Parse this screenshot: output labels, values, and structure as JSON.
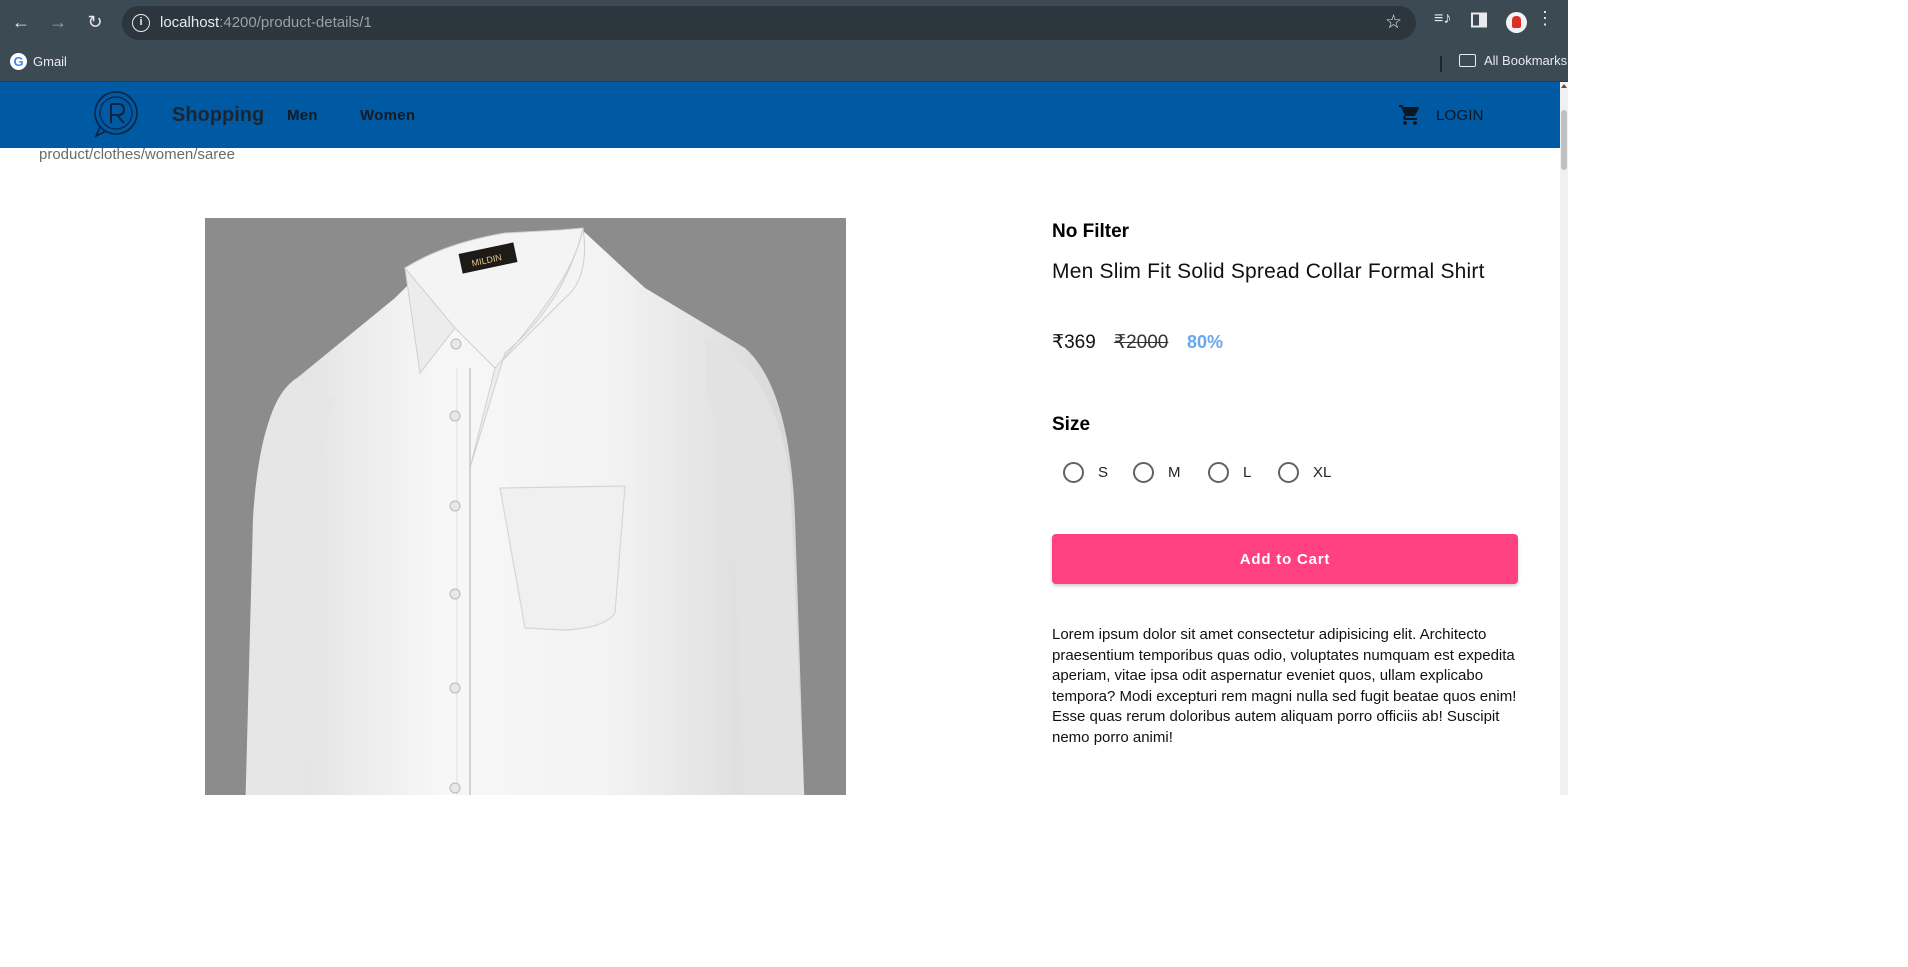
{
  "browser": {
    "url_host": "localhost",
    "url_path": ":4200/product-details/1",
    "bookmarks": {
      "gmail": "Gmail",
      "all": "All Bookmarks"
    }
  },
  "toolbar": {
    "brand": "Shopping",
    "nav": [
      "Men",
      "Women"
    ],
    "login": "LOGIN"
  },
  "breadcrumb": "product/clothes/women/saree",
  "product": {
    "image_label": "MILDIN",
    "filter_title": "No Filter",
    "title": "Men Slim Fit Solid Spread Collar Formal Shirt",
    "price": "₹369",
    "mrp": "₹2000",
    "discount": "80%",
    "size_title": "Size",
    "sizes": [
      "S",
      "M",
      "L",
      "XL"
    ],
    "add_to_cart": "Add to Cart",
    "description": "Lorem ipsum dolor sit amet consectetur adipisicing elit. Architecto praesentium temporibus quas odio, voluptates numquam est expedita aperiam, vitae ipsa odit aspernatur eveniet quos, ullam explicabo tempora? Modi excepturi rem magni nulla sed fugit beatae quos enim! Esse quas rerum doloribus autem aliquam porro officiis ab! Suscipit nemo porro animi!"
  },
  "colors": {
    "toolbar": "#0059a3",
    "accent": "#ff4081",
    "discount": "#6aa6ea"
  },
  "icons": [
    "back-icon",
    "forward-icon",
    "reload-icon",
    "info-icon",
    "star-icon",
    "media-icon",
    "side-panel-icon",
    "menu-icon",
    "folder-icon",
    "cart-icon"
  ]
}
